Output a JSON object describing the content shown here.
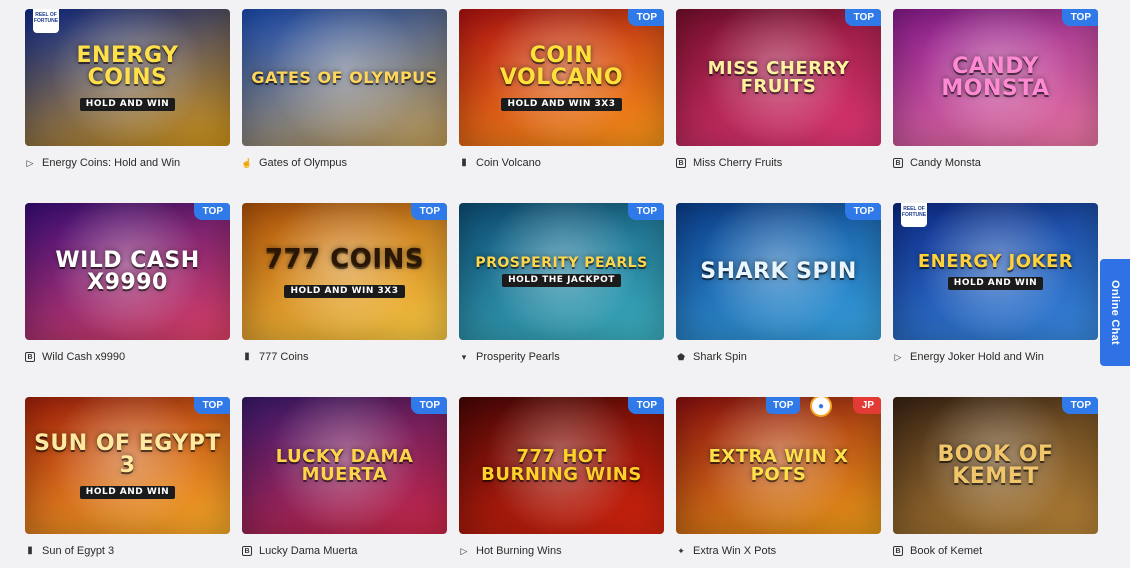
{
  "games": [
    {
      "name": "Energy Coins: Hold and Win",
      "art_title": "Energy Coins",
      "art_sub": "Hold and Win",
      "provider_icon": "play-triangle-icon",
      "badge": "",
      "corner": "reel-of-fortune",
      "corner_text": "REEL OF FORTUNE",
      "bg1": "#0f2c8f",
      "bg2": "#d89a1a",
      "title_color": "#ffe04a",
      "title_size": 22
    },
    {
      "name": "Gates of Olympus",
      "art_title": "Gates of Olympus",
      "art_sub": "",
      "provider_icon": "hand-pointer-icon",
      "badge": "",
      "corner": "",
      "corner_text": "",
      "bg1": "#1c4fb6",
      "bg2": "#c9a35a",
      "title_color": "#ffd65a",
      "title_size": 16
    },
    {
      "name": "Coin Volcano",
      "art_title": "Coin Volcano",
      "art_sub": "Hold and Win 3x3",
      "provider_icon": "cube-icon",
      "badge": "TOP",
      "corner": "",
      "corner_text": "",
      "bg1": "#b31212",
      "bg2": "#ff9a1a",
      "title_color": "#ffdf3a",
      "title_size": 22
    },
    {
      "name": "Miss Cherry Fruits",
      "art_title": "Miss Cherry Fruits",
      "art_sub": "",
      "provider_icon": "b-square-icon",
      "badge": "TOP",
      "corner": "",
      "corner_text": "",
      "bg1": "#7a0f2e",
      "bg2": "#e93a7a",
      "title_color": "#fff1a0",
      "title_size": 18
    },
    {
      "name": "Candy Monsta",
      "art_title": "Candy Monsta",
      "art_sub": "",
      "provider_icon": "b-square-icon",
      "badge": "TOP",
      "corner": "",
      "corner_text": "",
      "bg1": "#8a1a8f",
      "bg2": "#f07aa6",
      "title_color": "#ff8ad3",
      "title_size": 22
    },
    {
      "name": "Wild Cash x9990",
      "art_title": "Wild Cash x9990",
      "art_sub": "",
      "provider_icon": "b-square-icon",
      "badge": "TOP",
      "corner": "",
      "corner_text": "",
      "bg1": "#3a0d7a",
      "bg2": "#e6456b",
      "title_color": "#ffffff",
      "title_size": 22
    },
    {
      "name": "777 Coins",
      "art_title": "777 Coins",
      "art_sub": "Hold and Win 3x3",
      "provider_icon": "cube-icon",
      "badge": "TOP",
      "corner": "",
      "corner_text": "",
      "bg1": "#b35309",
      "bg2": "#ffd045",
      "title_color": "#2a1602",
      "title_size": 26
    },
    {
      "name": "Prosperity Pearls",
      "art_title": "Prosperity Pearls",
      "art_sub": "Hold the Jackpot",
      "provider_icon": "chevron-down-icon",
      "badge": "TOP",
      "corner": "",
      "corner_text": "",
      "bg1": "#0e4f78",
      "bg2": "#3fb6c6",
      "title_color": "#ffd64a",
      "title_size": 14
    },
    {
      "name": "Shark Spin",
      "art_title": "Shark Spin",
      "art_sub": "",
      "provider_icon": "shield-icon",
      "badge": "TOP",
      "corner": "",
      "corner_text": "",
      "bg1": "#0b3f8f",
      "bg2": "#3aa9e6",
      "title_color": "#e9f6ff",
      "title_size": 22
    },
    {
      "name": "Energy Joker Hold and Win",
      "art_title": "Energy Joker",
      "art_sub": "Hold and Win",
      "provider_icon": "play-triangle-icon",
      "badge": "",
      "corner": "reel-of-fortune",
      "corner_text": "REEL OF FORTUNE",
      "bg1": "#0d2a8a",
      "bg2": "#3b8fe6",
      "title_color": "#ffd13a",
      "title_size": 18
    },
    {
      "name": "Sun of Egypt 3",
      "art_title": "Sun of Egypt 3",
      "art_sub": "Hold and Win",
      "provider_icon": "cube-icon",
      "badge": "TOP",
      "corner": "",
      "corner_text": "",
      "bg1": "#a8210b",
      "bg2": "#ffb12a",
      "title_color": "#ffe9a0",
      "title_size": 22
    },
    {
      "name": "Lucky Dama Muerta",
      "art_title": "Lucky Dama Muerta",
      "art_sub": "",
      "provider_icon": "b-square-icon",
      "badge": "TOP",
      "corner": "",
      "corner_text": "",
      "bg1": "#3a1a6e",
      "bg2": "#d4294a",
      "title_color": "#ffd44a",
      "title_size": 18
    },
    {
      "name": "Hot Burning Wins",
      "art_title": "777 Hot Burning Wins",
      "art_sub": "",
      "provider_icon": "play-triangle-icon",
      "badge": "TOP",
      "corner": "",
      "corner_text": "",
      "bg1": "#4a0606",
      "bg2": "#e2270f",
      "title_color": "#ffcf2a",
      "title_size": 18
    },
    {
      "name": "Extra Win X Pots",
      "art_title": "Extra Win X Pots",
      "art_sub": "",
      "provider_icon": "puzzle-icon",
      "badge": "JP",
      "corner": "top-left-badge",
      "corner_text": "TOP",
      "bg1": "#8f0f0f",
      "bg2": "#f2a01a",
      "title_color": "#ffe04a",
      "title_size": 18
    },
    {
      "name": "Book of Kemet",
      "art_title": "Book of Kemet",
      "art_sub": "",
      "provider_icon": "b-square-icon",
      "badge": "TOP",
      "corner": "",
      "corner_text": "",
      "bg1": "#3a2414",
      "bg2": "#c08a3a",
      "title_color": "#f1c66a",
      "title_size": 22
    }
  ],
  "online_chat": {
    "label": "Online Chat"
  }
}
